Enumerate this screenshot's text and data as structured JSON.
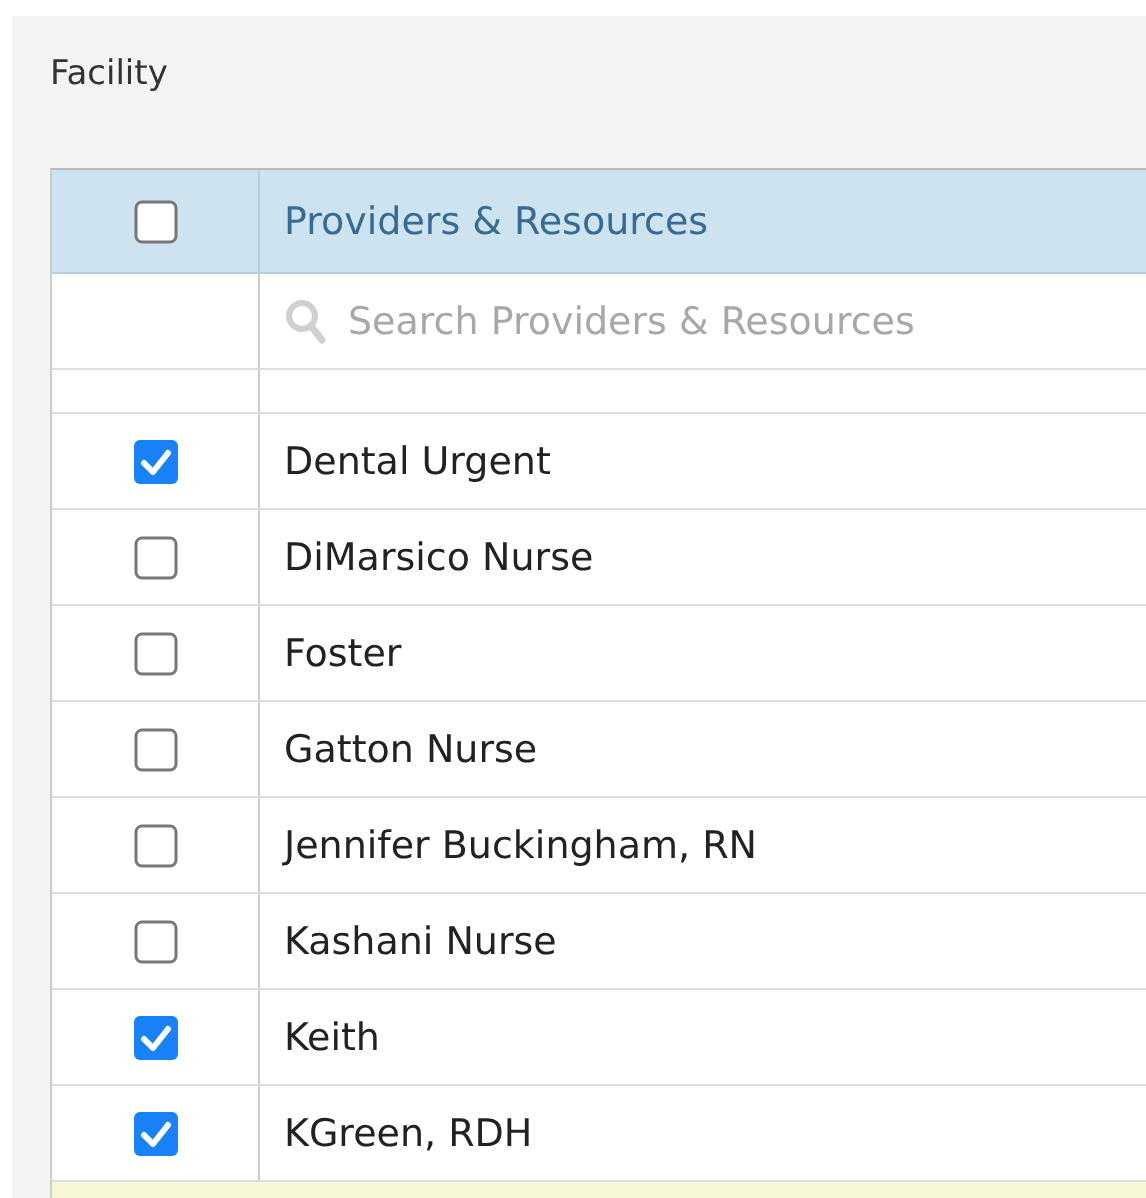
{
  "facility_label": "Facility",
  "table": {
    "header": {
      "label": "Providers & Resources",
      "checked": false
    },
    "search": {
      "placeholder": "Search Providers & Resources"
    },
    "rows": [
      {
        "name": "Dental Urgent",
        "checked": true
      },
      {
        "name": "DiMarsico Nurse",
        "checked": false
      },
      {
        "name": "Foster",
        "checked": false
      },
      {
        "name": "Gatton Nurse",
        "checked": false
      },
      {
        "name": "Jennifer Buckingham, RN",
        "checked": false
      },
      {
        "name": "Kashani Nurse",
        "checked": false
      },
      {
        "name": "Keith",
        "checked": true
      },
      {
        "name": "KGreen, RDH",
        "checked": true
      }
    ]
  }
}
